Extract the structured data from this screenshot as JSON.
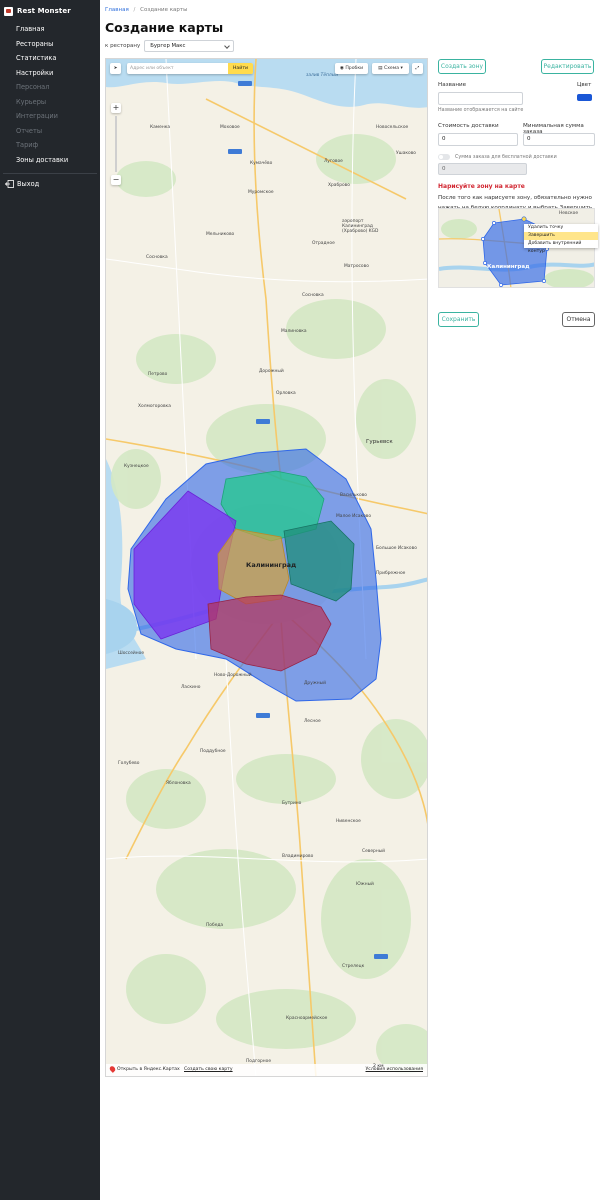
{
  "app": {
    "name": "Rest Monster"
  },
  "sidebar": {
    "items": [
      {
        "label": "Главная",
        "enabled": true
      },
      {
        "label": "Рестораны",
        "enabled": true
      },
      {
        "label": "Статистика",
        "enabled": true
      },
      {
        "label": "Настройки",
        "enabled": true
      },
      {
        "label": "Персонал",
        "enabled": false
      },
      {
        "label": "Курьеры",
        "enabled": false
      },
      {
        "label": "Интеграции",
        "enabled": false
      },
      {
        "label": "Отчеты",
        "enabled": false
      },
      {
        "label": "Тариф",
        "enabled": false
      },
      {
        "label": "Зоны доставки",
        "enabled": true
      }
    ],
    "logout_label": "Выход"
  },
  "breadcrumb": {
    "home": "Главная",
    "sep": "/",
    "current": "Создание карты"
  },
  "page": {
    "title": "Создание карты",
    "restaurant_label": "к ресторану",
    "restaurant_value": "Бургер Макс"
  },
  "map": {
    "search_placeholder": "Адрес или объект",
    "find_label": "Найти",
    "traffic_label": "Пробки",
    "layers_label": "Схема",
    "zoom_in": "+",
    "zoom_out": "−",
    "footer": {
      "open_in": "Открыть в Яндекс.Картах",
      "create_own": "Создать свою карту",
      "scale": "2 км",
      "terms": "Условия использования"
    },
    "labels": {
      "sea": "залив Тёплый",
      "kaliningrad": "Калининград",
      "guryevsk": "Гурьевск",
      "airport": "аэропорт Калининград (Храброво) KGD",
      "places": [
        "Моховое",
        "Новосельское",
        "Каменка",
        "Луговое",
        "Ушаково",
        "Кумачёво",
        "Храброво",
        "Муромское",
        "Красноflotskoe",
        "Отрадное",
        "Мельниково",
        "Матросово",
        "Сосновка",
        "Малиновка",
        "Петрово",
        "Дорожный",
        "Орловка",
        "Холмогоровка",
        "Васильково",
        "Малое Исаково",
        "Большое Исаково",
        "Прибрежное",
        "Ласкино",
        "Шоссейное",
        "Ново-Дорожный",
        "Дружный",
        "Лесное",
        "Поддубное",
        "Голубево",
        "Яблоновка",
        "Бутрино",
        "Нивенское",
        "Владимирово",
        "Северный",
        "Южный",
        "Победа",
        "Стрелецк",
        "Победа",
        "Красноармейское",
        "Подгорное",
        "Кузнецкое",
        "Сосновка"
      ]
    }
  },
  "zone_form": {
    "create_zone_label": "Создать зону",
    "edit_label": "Редактировать",
    "name_label": "Название",
    "name_value": "",
    "name_hint": "Название отображается на сайте",
    "color_label": "Цвет",
    "color_value": "#1a57d6",
    "delivery_cost_label": "Стоимость доставки",
    "delivery_cost_value": "0",
    "min_order_label": "Минимальная сумма заказа",
    "min_order_value": "0",
    "free_delivery_label": "Сумма заказа для бесплатной доставки",
    "free_delivery_value": "0",
    "free_delivery_enabled": false,
    "draw_title": "Нарисуйте зону на карте",
    "draw_text": "После того как нарисуете зону, обязательно нужно нажать на белую координату и выбрать Завершить",
    "preview_city": "Калининград",
    "preview_place": "Невское",
    "context_menu": [
      "Удалить точку",
      "Завершить",
      "Добавить внутренний контур"
    ],
    "save_label": "Сохранить",
    "cancel_label": "Отмена"
  },
  "colors": {
    "sidebar_bg": "#23272c",
    "accent_teal": "#3ab3a0",
    "link_blue": "#2f6fdc",
    "warning_red": "#d1242f",
    "zone_blue": "#2f67e8",
    "zone_green": "#23c98c",
    "zone_purple": "#7b2ff0",
    "zone_gold": "#d4a33a",
    "zone_teal": "#1f8e79",
    "zone_red": "#b4345c"
  }
}
